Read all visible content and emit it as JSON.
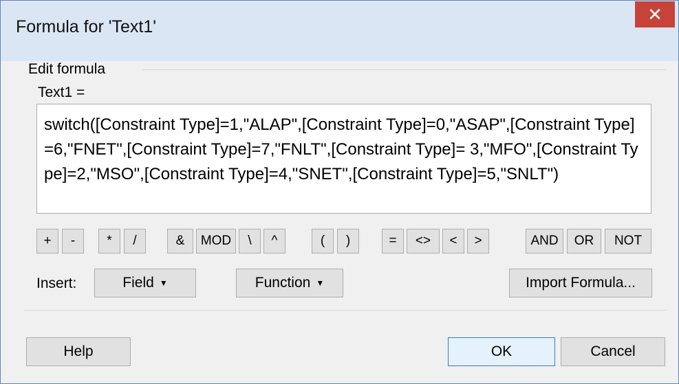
{
  "window": {
    "title": "Formula for 'Text1'"
  },
  "group": {
    "label": "Edit formula",
    "mnemonic": "E"
  },
  "field_label": "Text1 =",
  "formula": "switch([Constraint Type]=1,\"ALAP\",[Constraint Type]=0,\"ASAP\",[Constraint Type]=6,\"FNET\",[Constraint Type]=7,\"FNLT\",[Constraint Type]= 3,\"MFO\",[Constraint Type]=2,\"MSO\",[Constraint Type]=4,\"SNET\",[Constraint Type]=5,\"SNLT\")",
  "operators": [
    "+",
    "-",
    "*",
    "/",
    "&",
    "MOD",
    "\\",
    "^",
    "(",
    ")",
    "=",
    "<>",
    "<",
    ">",
    "AND",
    "OR",
    "NOT"
  ],
  "insert": {
    "label": "Insert:",
    "field_button": "Field",
    "function_button": "Function",
    "import_button": "Import Formula..."
  },
  "buttons": {
    "help": "Help",
    "ok": "OK",
    "cancel": "Cancel"
  },
  "icons": {
    "close": "close-icon",
    "dropdown": "caret-down-icon"
  },
  "colors": {
    "close": "#c7433a",
    "titlebar": "#dbe6f4",
    "ok_border": "#3c7fb1"
  }
}
